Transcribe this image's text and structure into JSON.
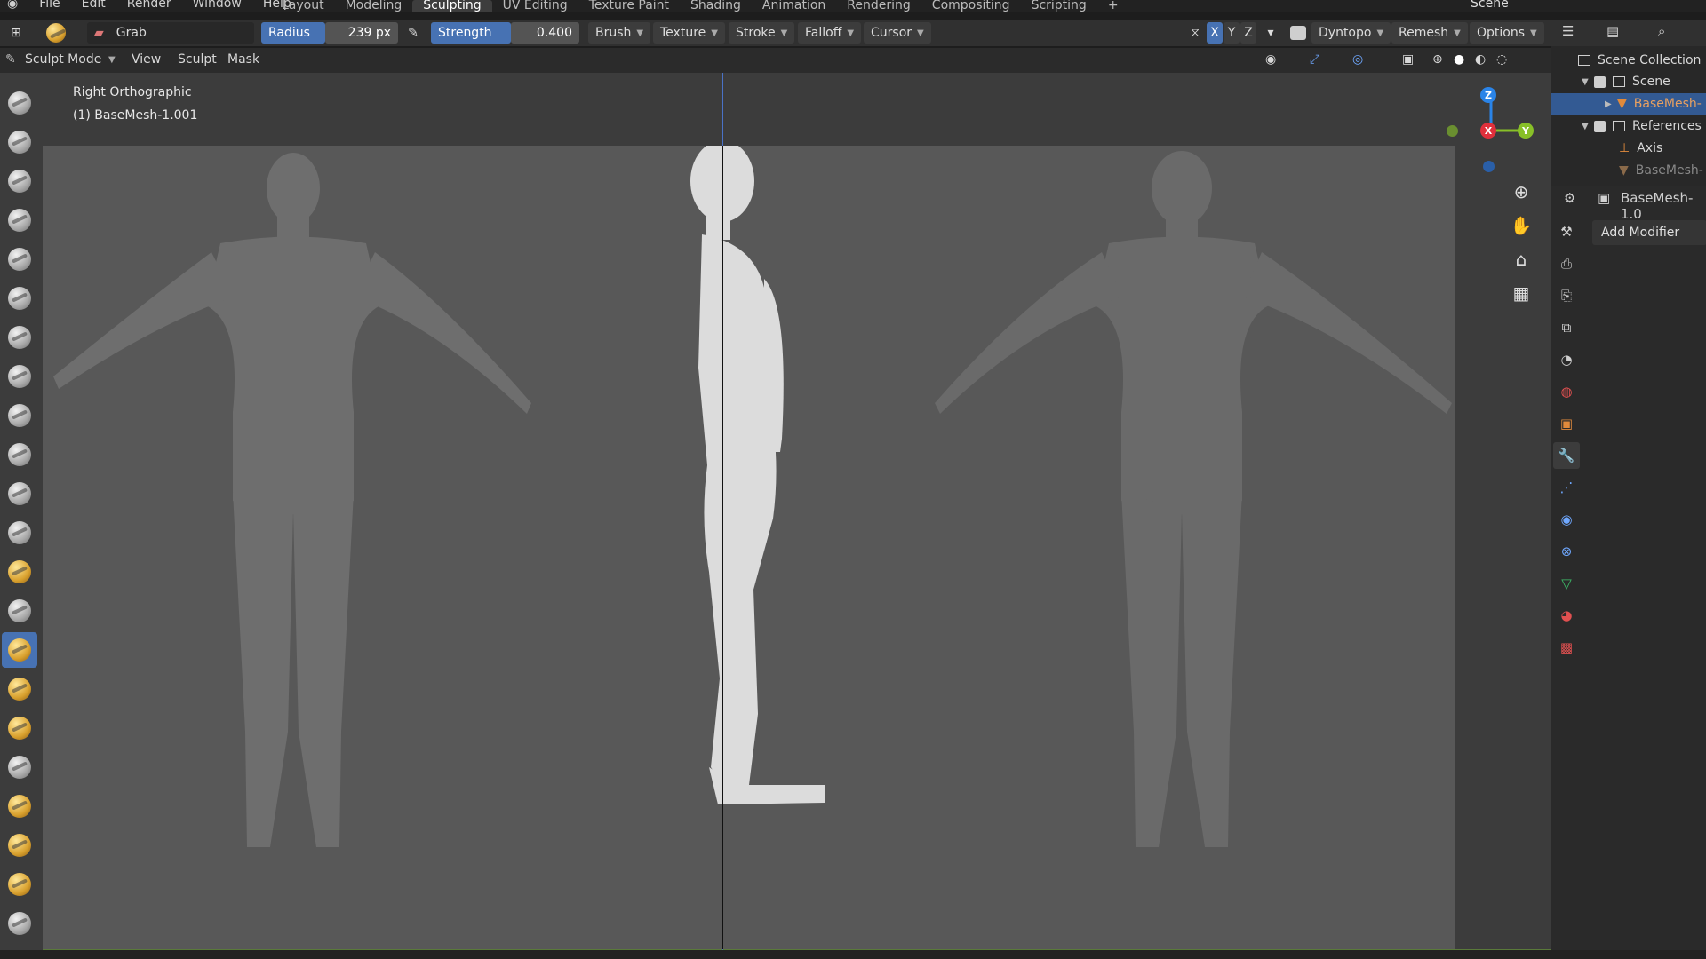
{
  "menu": [
    "File",
    "Edit",
    "Render",
    "Window",
    "Help"
  ],
  "workspace_tabs": [
    "Layout",
    "Modeling",
    "Sculpting",
    "UV Editing",
    "Texture Paint",
    "Shading",
    "Animation",
    "Rendering",
    "Compositing",
    "Scripting",
    "+"
  ],
  "active_tab": "Sculpting",
  "scene_name": "Scene",
  "toolbar": {
    "brush_name": "Grab",
    "radius_label": "Radius",
    "radius_value": "239 px",
    "strength_label": "Strength",
    "strength_value": "0.400",
    "brush_menu": "Brush",
    "texture_menu": "Texture",
    "stroke_menu": "Stroke",
    "falloff_menu": "Falloff",
    "cursor_menu": "Cursor",
    "axis_x": "X",
    "axis_y": "Y",
    "axis_z": "Z",
    "dyntopo": "Dyntopo",
    "remesh": "Remesh",
    "options": "Options"
  },
  "mode_header": {
    "mode": "Sculpt Mode",
    "view": "View",
    "sculpt": "Sculpt",
    "mask": "Mask"
  },
  "viewport": {
    "view_name": "Right Orthographic",
    "object_info": "(1) BaseMesh-1.001",
    "gizmo": {
      "x": "X",
      "y": "Y",
      "z": "Z"
    }
  },
  "outliner": {
    "title": "Scene Collection",
    "rows": [
      {
        "label": "Scene"
      },
      {
        "label": "BaseMesh-"
      },
      {
        "label": "References"
      },
      {
        "label": "Axis"
      },
      {
        "label": "BaseMesh-"
      }
    ]
  },
  "properties": {
    "object_name": "BaseMesh-1.0",
    "add_modifier": "Add Modifier"
  },
  "colors": {
    "accent": "#4772b3",
    "selection": "#335a93",
    "x_axis": "#e0303c",
    "y_axis": "#88c028",
    "z_axis": "#2a84e8"
  }
}
